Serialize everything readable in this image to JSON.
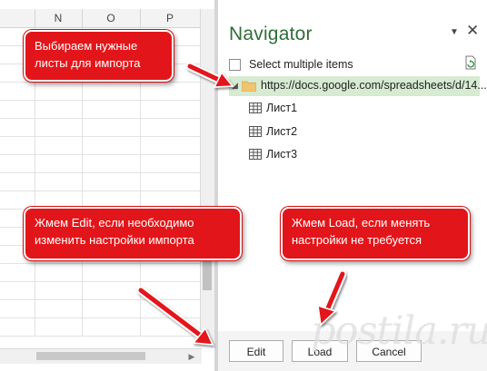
{
  "spreadsheet": {
    "columns": [
      "N",
      "O",
      "P"
    ]
  },
  "navigator": {
    "title": "Navigator",
    "select_multiple_label": "Select multiple items",
    "source_url": "https://docs.google.com/spreadsheets/d/14...",
    "sheets": [
      "Лист1",
      "Лист2",
      "Лист3"
    ],
    "buttons": {
      "edit": "Edit",
      "load": "Load",
      "cancel": "Cancel"
    }
  },
  "callouts": {
    "select_sheets": "Выбираем нужные листы для импорта",
    "edit_hint": "Жмем Edit, если необходимо изменить настройки импорта",
    "load_hint": "Жмем Load, если менять настройки не требуется"
  },
  "watermark": "postila.ru",
  "colors": {
    "callout": "#e2161a",
    "navigator_title": "#2f6f37",
    "selected_row": "#d6ebd2"
  }
}
